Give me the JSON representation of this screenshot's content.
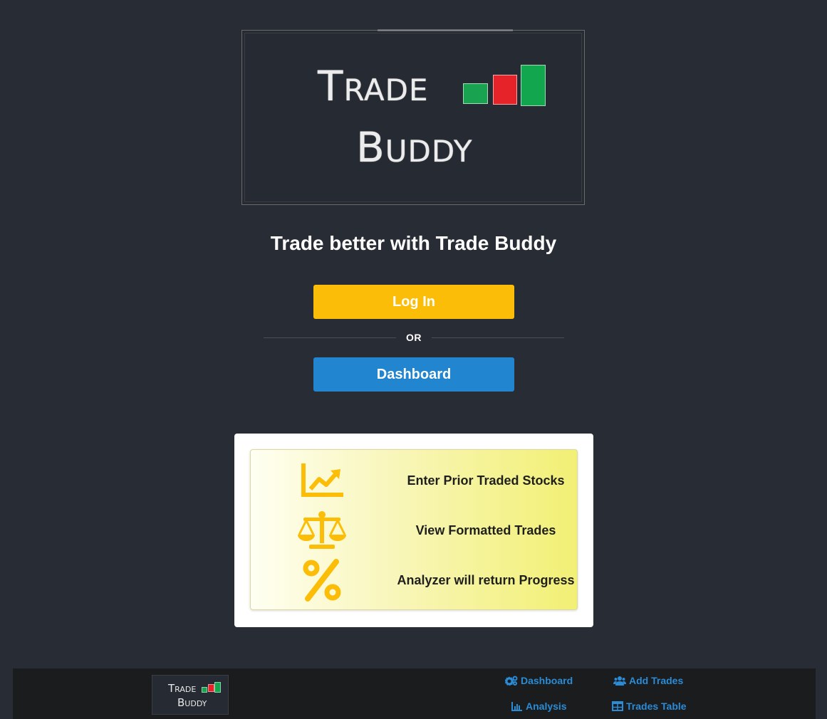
{
  "logo": {
    "line1": "Trade",
    "line2": "Buddy",
    "bar_colors": [
      "#19a24f",
      "#e52329",
      "#12a64e"
    ]
  },
  "hero": {
    "tagline": "Trade better with Trade Buddy"
  },
  "actions": {
    "login_label": "Log In",
    "divider_label": "OR",
    "dashboard_label": "Dashboard"
  },
  "features": [
    {
      "icon": "line-chart-icon",
      "text": "Enter Prior Traded Stocks"
    },
    {
      "icon": "balance-scale-icon",
      "text": "View Formatted Trades"
    },
    {
      "icon": "percent-icon",
      "text": "Analyzer will return Progress"
    }
  ],
  "footer": {
    "logo_line1": "Trade",
    "logo_line2": "Buddy",
    "links": [
      {
        "icon": "cogs-icon",
        "label": "Dashboard"
      },
      {
        "icon": "users-icon",
        "label": "Add Trades"
      },
      {
        "icon": "bar-chart-icon",
        "label": "Analysis"
      },
      {
        "icon": "table-icon",
        "label": "Trades Table"
      }
    ]
  },
  "colors": {
    "background": "#282c34",
    "login": "#fbbd08",
    "primary": "#2185d0",
    "icon_yellow": "#fbbd08",
    "footer_bg": "#1b1c1d",
    "link": "#2a8bd6"
  }
}
